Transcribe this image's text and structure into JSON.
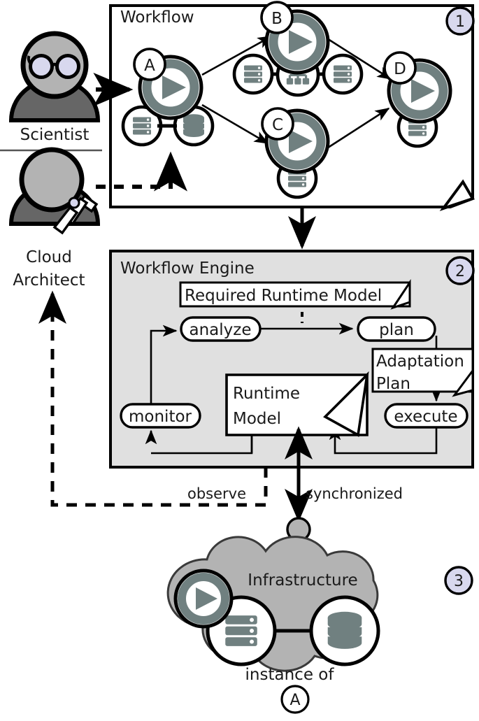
{
  "actors": [
    {
      "id": "scientist",
      "label": "Scientist",
      "icon": "person-with-glasses-icon",
      "head_fill": "#b3b3b3",
      "body_fill": "#666666",
      "lens_fill": "#d8d8ee"
    },
    {
      "id": "cloud-architect",
      "label": "Cloud Architect",
      "label_line1": "Cloud",
      "label_line2": "Architect",
      "icon": "person-with-tool-icon",
      "head_fill": "#b3b3b3",
      "body_fill": "#666666"
    }
  ],
  "panels": [
    {
      "id": "workflow",
      "title": "Workflow",
      "badge": "1",
      "fill": "#ffffff"
    },
    {
      "id": "workflow-engine",
      "title": "Workflow Engine",
      "badge": "2",
      "fill": "#e0e0e0"
    },
    {
      "id": "infrastructure",
      "title": "Infrastructure",
      "badge": "3",
      "fill": "#b3b3b3"
    }
  ],
  "workflow": {
    "title": "Workflow",
    "badge": "1",
    "nodes": [
      {
        "id": "A",
        "label": "A",
        "icon": "play-icon",
        "resources": [
          "server-icon",
          "database-icon"
        ]
      },
      {
        "id": "B",
        "label": "B",
        "icon": "play-icon",
        "resources": [
          "server-icon",
          "network-icon",
          "server-icon"
        ]
      },
      {
        "id": "C",
        "label": "C",
        "icon": "play-icon",
        "resources": [
          "server-icon"
        ]
      },
      {
        "id": "D",
        "label": "D",
        "icon": "play-icon",
        "resources": [
          "server-icon"
        ]
      }
    ],
    "edges": [
      {
        "from": "A",
        "to": "B"
      },
      {
        "from": "A",
        "to": "C"
      },
      {
        "from": "B",
        "to": "D"
      },
      {
        "from": "C",
        "to": "D"
      }
    ]
  },
  "engine": {
    "title": "Workflow Engine",
    "badge": "2",
    "artifacts": [
      {
        "id": "required-runtime-model",
        "label": "Required Runtime Model",
        "shape": "uml-artifact"
      },
      {
        "id": "adaptation-plan",
        "label": "Adaptation Plan",
        "label_line1": "Adaptation",
        "label_line2": "Plan",
        "shape": "uml-artifact"
      },
      {
        "id": "runtime-model",
        "label": "Runtime Model",
        "label_line1": "Runtime",
        "label_line2": "Model",
        "shape": "uml-artifact"
      }
    ],
    "activities": [
      {
        "id": "monitor",
        "label": "monitor"
      },
      {
        "id": "analyze",
        "label": "analyze"
      },
      {
        "id": "plan",
        "label": "plan"
      },
      {
        "id": "execute",
        "label": "execute"
      }
    ]
  },
  "infrastructure": {
    "title": "Infrastructure",
    "badge": "3",
    "instance_label": "instance of",
    "instance_node": "A",
    "icons": [
      "play-icon",
      "server-icon",
      "database-icon"
    ],
    "fill": "#b3b3b3"
  },
  "connections": [
    {
      "id": "observe",
      "label": "observe",
      "style": "dashed"
    },
    {
      "id": "synchronized",
      "label": "synchronized",
      "style": "solid"
    }
  ],
  "colors": {
    "accent_teal": "#708080",
    "badge_fill": "#d8d8ee",
    "panel_gray": "#e0e0e0",
    "cloud_gray": "#b3b3b3",
    "actor_body": "#666666",
    "actor_head": "#b3b3b3",
    "stroke": "#000000",
    "text": "#1a1a1a"
  }
}
